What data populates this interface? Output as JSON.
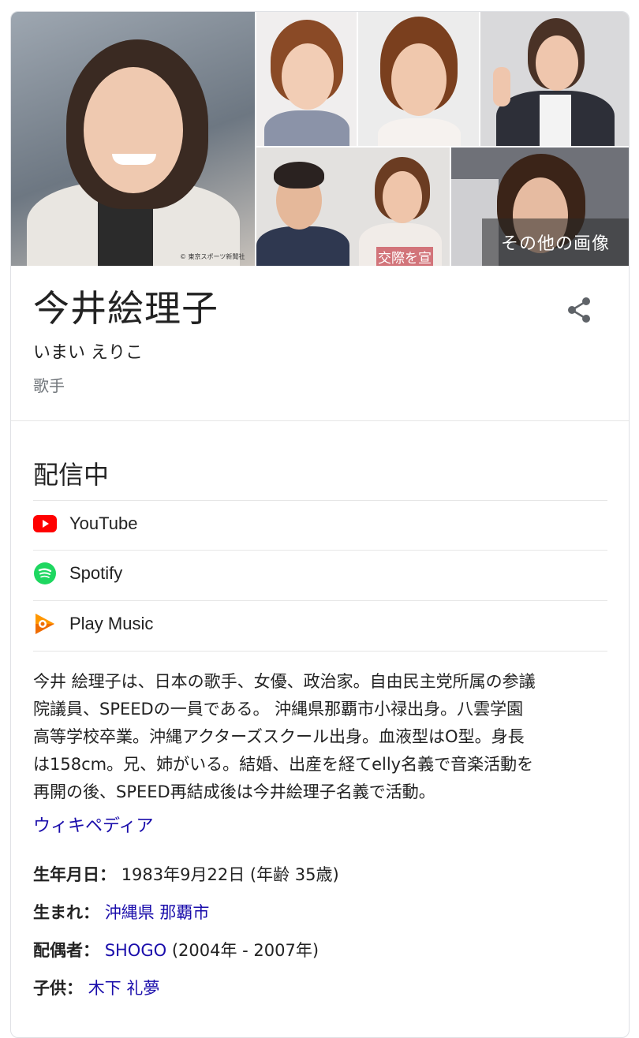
{
  "images": {
    "watermark": "© 東京スポーツ新聞社",
    "overlay_caption": "交際を宣",
    "more_images_label": "その他の画像"
  },
  "entity": {
    "name": "今井絵理子",
    "reading": "いまい えりこ",
    "subtitle": "歌手"
  },
  "streaming": {
    "heading": "配信中",
    "services": [
      {
        "label": "YouTube",
        "icon": "youtube-icon",
        "color": "#ff0000"
      },
      {
        "label": "Spotify",
        "icon": "spotify-icon",
        "color": "#1ed760"
      },
      {
        "label": "Play Music",
        "icon": "play-music-icon",
        "color": "#ef6c00"
      }
    ]
  },
  "description": {
    "lines": [
      "今井 絵理子は、日本の歌手、女優、政治家。自由民主党所属の参議",
      "院議員、SPEEDの一員である。 沖縄県那覇市小禄出身。八雲学園",
      "高等学校卒業。沖縄アクターズスクール出身。血液型はO型。身長",
      "は158cm。兄、姉がいる。結婚、出産を経てelly名義で音楽活動を",
      "再開の後、SPEED再結成後は今井絵理子名義で活動。"
    ],
    "source_link": "ウィキペディア"
  },
  "facts": {
    "birth": {
      "key": "生年月日：",
      "value": "1983年9月22日 (年齢 35歳)"
    },
    "born": {
      "key": "生まれ：",
      "link": "沖縄県 那覇市"
    },
    "spouse": {
      "key": "配偶者：",
      "link": "SHOGO",
      "suffix": " (2004年 - 2007年)"
    },
    "child": {
      "key": "子供：",
      "link": "木下 礼夢"
    }
  },
  "colors": {
    "link": "#1a0dab",
    "secondary_text": "#70757a",
    "divider": "#e6e6e6"
  }
}
